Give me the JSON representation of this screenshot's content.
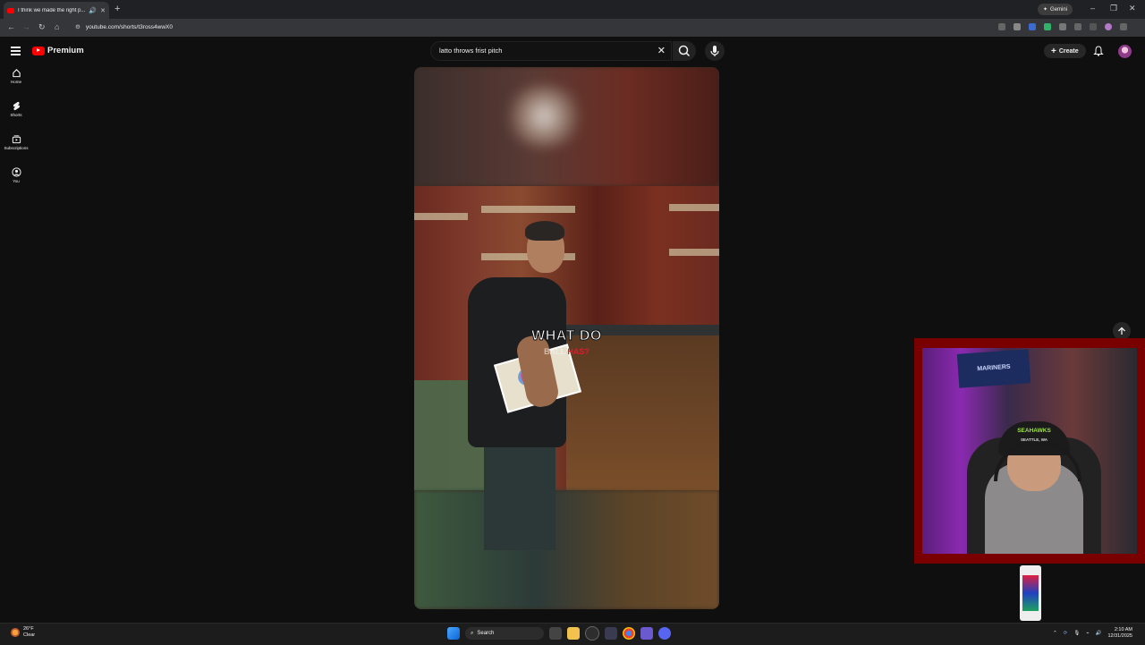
{
  "browser": {
    "tab_title": "I think we made the right p...",
    "url": "youtube.com/shorts/t3ross4wwX0",
    "gemini_label": "Gemini"
  },
  "youtube": {
    "logo_text": "Premium",
    "search_value": "latto throws frist pitch",
    "create_label": "Create",
    "rail": [
      {
        "label": "Home",
        "icon": "home-icon"
      },
      {
        "label": "Shorts",
        "icon": "shorts-icon"
      },
      {
        "label": "Subscriptions",
        "icon": "subscriptions-icon"
      },
      {
        "label": "You",
        "icon": "you-icon"
      }
    ]
  },
  "video": {
    "caption_line1": "WHAT DO",
    "caption_line2a": "BALL",
    "caption_line2b": "HAS?"
  },
  "webcam": {
    "banner_text": "MARINERS",
    "cap_text": "SEAHAWKS",
    "cap_subtext": "SEATTLE, WA"
  },
  "taskbar": {
    "weather_temp": "26°F",
    "weather_cond": "Clear",
    "search_label": "Search",
    "time": "2:10 AM",
    "date": "12/31/2025"
  },
  "colors": {
    "youtube_red": "#ff0000",
    "webcam_frame": "#7a0000",
    "page_bg": "#0f0f0f"
  }
}
